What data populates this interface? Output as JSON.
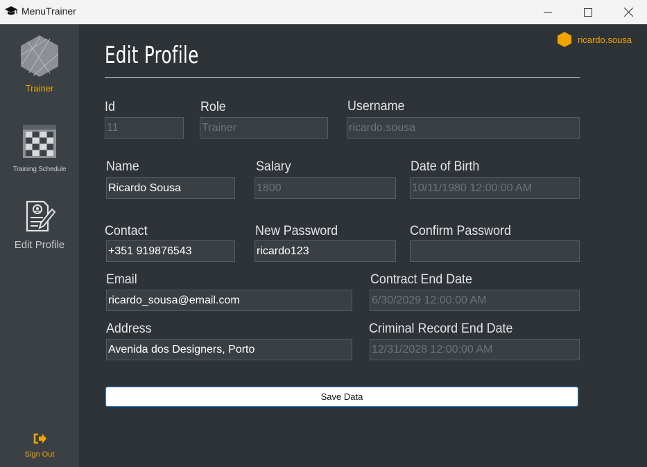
{
  "window": {
    "title": "MenuTrainer"
  },
  "sidebar": {
    "items": [
      {
        "label": "Trainer"
      },
      {
        "label": "Training Schedule"
      },
      {
        "label": "Edit Profile"
      }
    ],
    "sign_out": "Sign Out"
  },
  "header": {
    "username": "ricardo.sousa",
    "page_title": "Edit Profile"
  },
  "form": {
    "id": {
      "label": "Id",
      "value": "11"
    },
    "role": {
      "label": "Role",
      "value": "Trainer"
    },
    "username": {
      "label": "Username",
      "value": "ricardo.sousa"
    },
    "name": {
      "label": "Name",
      "value": "Ricardo Sousa"
    },
    "salary": {
      "label": "Salary",
      "value": "1800"
    },
    "dob": {
      "label": "Date of Birth",
      "value": "10/11/1980 12:00:00 AM"
    },
    "contact": {
      "label": "Contact",
      "value": "+351 919876543"
    },
    "new_password": {
      "label": "New Password",
      "value": "ricardo123"
    },
    "confirm_password": {
      "label": "Confirm Password",
      "value": ""
    },
    "email": {
      "label": "Email",
      "value": "ricardo_sousa@email.com"
    },
    "contract_end": {
      "label": "Contract End Date",
      "value": "6/30/2029 12:00:00 AM"
    },
    "address": {
      "label": "Address",
      "value": "Avenida dos Designers, Porto"
    },
    "criminal_record_end": {
      "label": "Criminal Record End Date",
      "value": "12/31/2028 12:00:00 AM"
    },
    "save_label": "Save Data"
  },
  "colors": {
    "accent": "#f0a500",
    "sidebar": "#3b4045",
    "background": "#2e3338",
    "button_border": "#2a86d8"
  },
  "icons": [
    "graduation-cap-icon",
    "hexagon-logo-icon",
    "calendar-grid-icon",
    "profile-document-icon",
    "sign-out-icon",
    "user-hexagon-icon"
  ]
}
